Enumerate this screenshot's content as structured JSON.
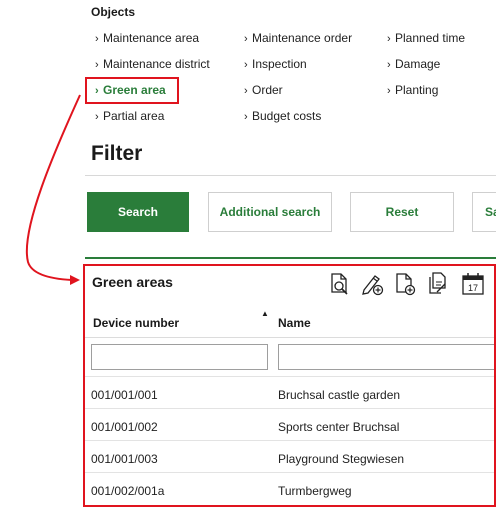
{
  "objects": {
    "title": "Objects",
    "items": [
      {
        "label": "Maintenance area"
      },
      {
        "label": "Maintenance order"
      },
      {
        "label": "Planned time"
      },
      {
        "label": "Maintenance district"
      },
      {
        "label": "Inspection"
      },
      {
        "label": "Damage"
      },
      {
        "label": "Green area",
        "active": true
      },
      {
        "label": "Order"
      },
      {
        "label": "Planting"
      },
      {
        "label": "Partial area"
      },
      {
        "label": "Budget costs"
      }
    ]
  },
  "filter": {
    "title": "Filter",
    "buttons": {
      "search": "Search",
      "additional_search": "Additional search",
      "reset": "Reset",
      "save": "Sa"
    }
  },
  "results": {
    "title": "Green areas",
    "columns": [
      "Device number",
      "Name"
    ],
    "rows": [
      {
        "device_number": "001/001/001",
        "name": "Bruchsal castle garden"
      },
      {
        "device_number": "001/001/002",
        "name": "Sports center Bruchsal"
      },
      {
        "device_number": "001/001/003",
        "name": "Playground Stegwiesen"
      },
      {
        "device_number": "001/002/001a",
        "name": "Turmbergweg"
      }
    ],
    "toolbar_icons": [
      "document-search-icon",
      "pencil-add-icon",
      "document-add-icon",
      "copy-document-icon",
      "calendar-icon"
    ],
    "calendar_day": "17"
  },
  "colors": {
    "accent_green": "#2a7d3a",
    "highlight_red": "#e0141e"
  }
}
